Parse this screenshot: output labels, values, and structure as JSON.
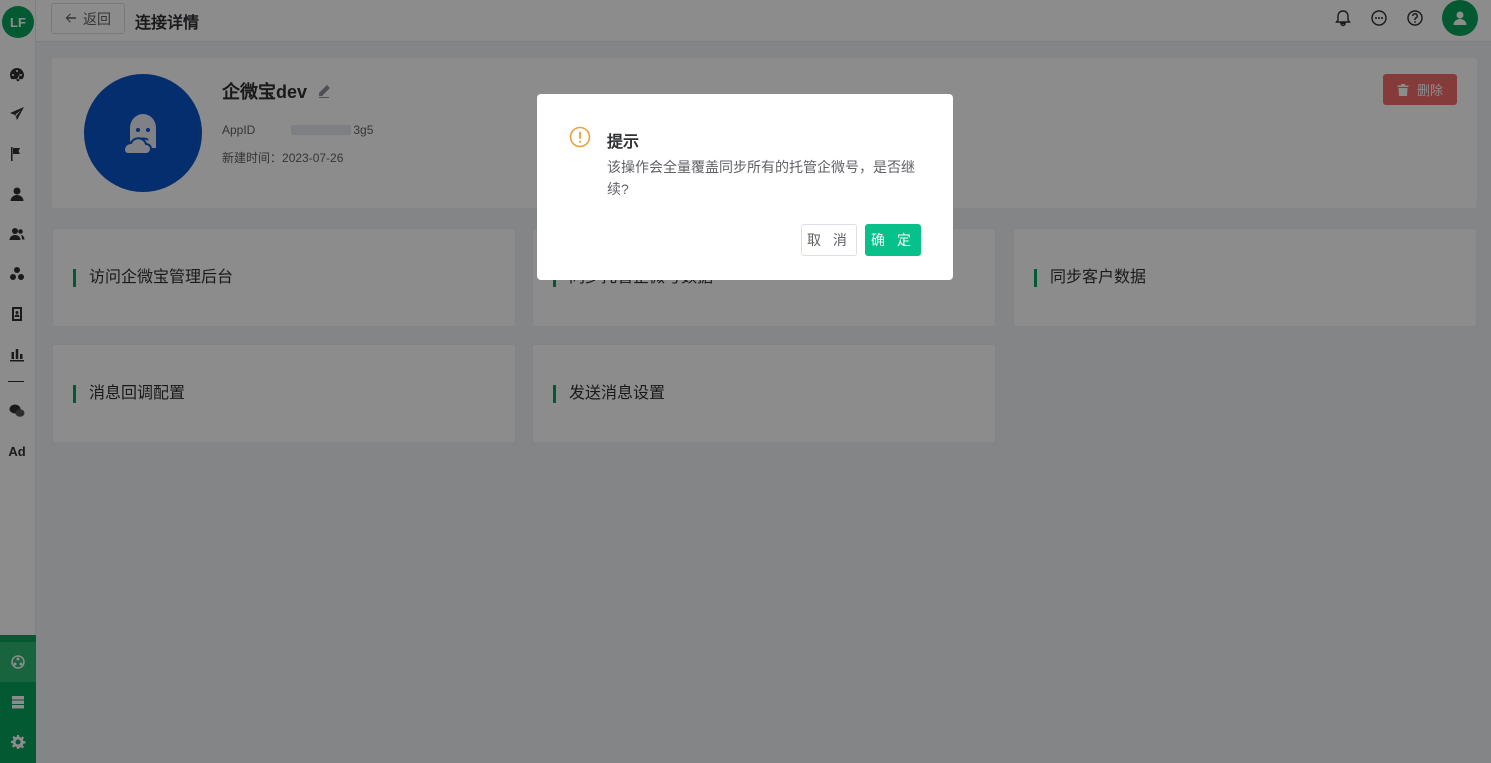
{
  "sidebar": {
    "logo_text": "LF",
    "ad_label": "Ad",
    "icons": [
      "dashboard-icon",
      "send-icon",
      "flag-icon",
      "user-icon",
      "users-icon",
      "group-icon",
      "contact-book-icon",
      "bar-chart-icon",
      "wechat-icon",
      "ad-icon"
    ],
    "bottom_icons": [
      "connect-icon",
      "server-icon",
      "gear-icon"
    ]
  },
  "header": {
    "back_label": "返回",
    "title": "连接详情"
  },
  "profile": {
    "name": "企微宝dev",
    "appid_label": "AppID",
    "appid_visible_suffix": "3g5",
    "created_label": "新建时间：",
    "created_date": "2023-07-26",
    "delete_label": "删除"
  },
  "cards": [
    {
      "label": "访问企微宝管理后台"
    },
    {
      "label": "同步托管企微号数据"
    },
    {
      "label": "同步客户数据"
    },
    {
      "label": "消息回调配置"
    },
    {
      "label": "发送消息设置"
    }
  ],
  "dialog": {
    "title": "提示",
    "message": "该操作会全量覆盖同步所有的托管企微号，是否继续?",
    "cancel_label": "取 消",
    "confirm_label": "确 定"
  },
  "colors": {
    "brand": "#07a35a",
    "confirm": "#07c08a",
    "danger": "#f56c6c",
    "warning": "#e6a23c",
    "avatar_bg": "#0a54c8"
  }
}
